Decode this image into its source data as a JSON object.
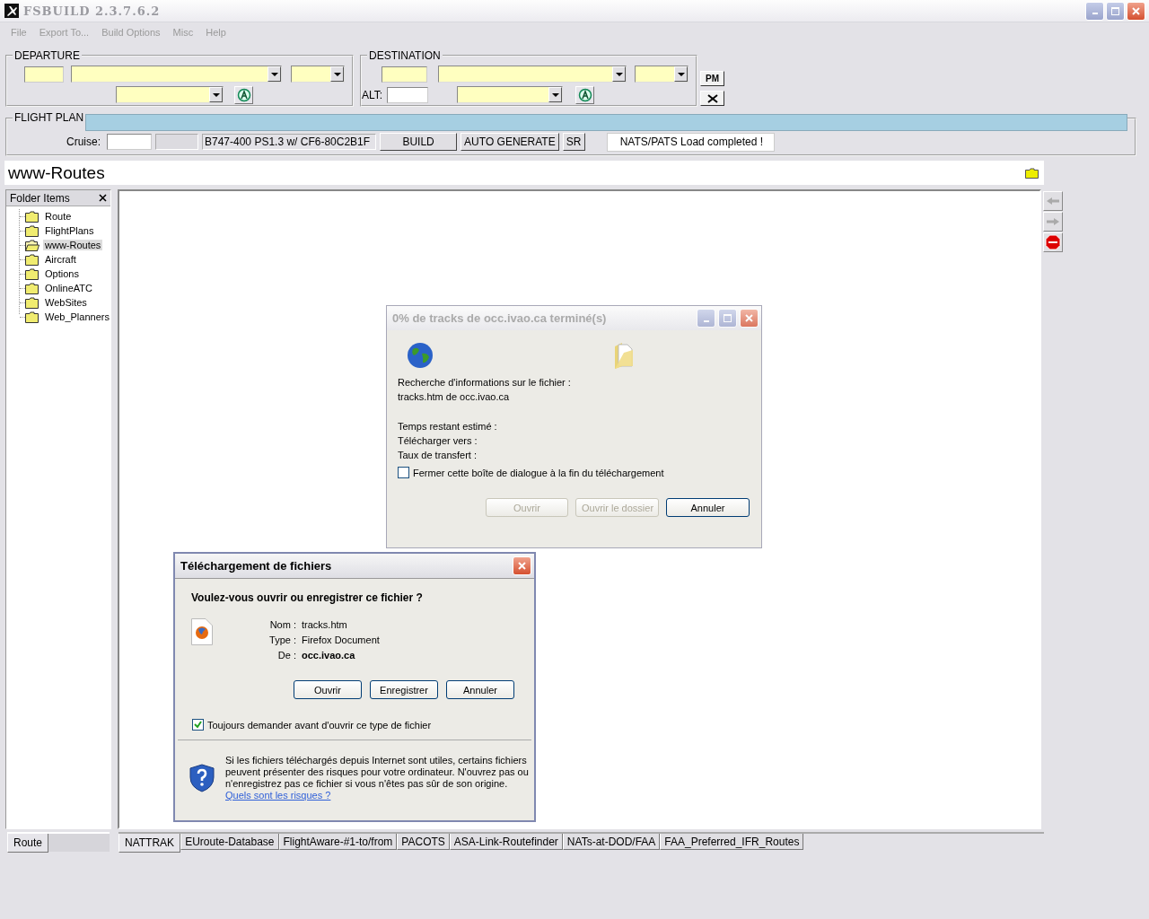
{
  "window": {
    "title": "FSBUILD 2.3.7.6.2"
  },
  "menu": [
    "File",
    "Export To...",
    "Build Options",
    "Misc",
    "Help"
  ],
  "departure": {
    "label": "DEPARTURE"
  },
  "destination": {
    "label": "DESTINATION",
    "alt_label": "ALT:"
  },
  "pm_button": "PM",
  "flight_plan": {
    "label": "FLIGHT PLAN",
    "cruise_label": "Cruise:",
    "aircraft": "B747-400 PS1.3 w/ CF6-80C2B1F",
    "buttons": [
      "BUILD",
      "AUTO GENERATE",
      "SR"
    ],
    "status": "NATS/PATS Load completed !"
  },
  "page_title": "www-Routes",
  "folder_panel": {
    "title": "Folder Items",
    "items": [
      {
        "label": "Route",
        "selected": false
      },
      {
        "label": "FlightPlans",
        "selected": false
      },
      {
        "label": "www-Routes",
        "selected": true
      },
      {
        "label": "Aircraft",
        "selected": false
      },
      {
        "label": "Options",
        "selected": false
      },
      {
        "label": "OnlineATC",
        "selected": false
      },
      {
        "label": "WebSites",
        "selected": false
      },
      {
        "label": "Web_Planners",
        "selected": false
      }
    ]
  },
  "left_tabs": [
    {
      "label": "Route",
      "selected": true
    }
  ],
  "tabs": [
    {
      "label": "NATTRAK",
      "selected": true
    },
    {
      "label": "EUroute-Database",
      "selected": false
    },
    {
      "label": "FlightAware-#1-to/from",
      "selected": false
    },
    {
      "label": "PACOTS",
      "selected": false
    },
    {
      "label": "ASA-Link-Routefinder",
      "selected": false
    },
    {
      "label": "NATs-at-DOD/FAA",
      "selected": false
    },
    {
      "label": "FAA_Preferred_IFR_Routes",
      "selected": false
    }
  ],
  "progress_dialog": {
    "title": "0% de tracks de occ.ivao.ca terminé(s)",
    "lines": [
      "Recherche d'informations sur le fichier :",
      "tracks.htm de occ.ivao.ca"
    ],
    "details": [
      "Temps restant estimé :",
      "Télécharger vers :",
      "Taux de transfert :"
    ],
    "checkbox": {
      "label": "Fermer cette boîte de dialogue à la fin du téléchargement",
      "checked": false
    },
    "buttons": [
      {
        "label": "Ouvrir",
        "disabled": true
      },
      {
        "label": "Ouvrir le dossier",
        "disabled": true
      },
      {
        "label": "Annuler",
        "disabled": false
      }
    ]
  },
  "download_dialog": {
    "title": "Téléchargement de fichiers",
    "question": "Voulez-vous ouvrir ou enregistrer ce fichier ?",
    "fields": [
      {
        "label": "Nom :",
        "value": "tracks.htm",
        "bold": false
      },
      {
        "label": "Type :",
        "value": "Firefox Document",
        "bold": false
      },
      {
        "label": "De :",
        "value": "occ.ivao.ca",
        "bold": true
      }
    ],
    "buttons": [
      "Ouvrir",
      "Enregistrer",
      "Annuler"
    ],
    "checkbox": {
      "label": "Toujours demander avant d'ouvrir ce type de fichier",
      "checked": true
    },
    "warning": "Si les fichiers téléchargés depuis Internet sont utiles, certains fichiers peuvent présenter des risques pour votre ordinateur. N'ouvrez pas ou n'enregistrez pas ce fichier si vous n'êtes pas sûr de son origine.",
    "link": "Quels sont les risques ?"
  }
}
